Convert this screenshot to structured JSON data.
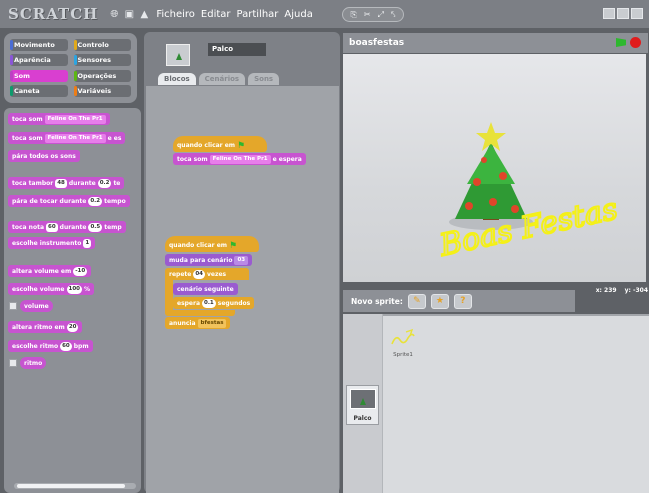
{
  "menubar": {
    "logo": "SCRATCH",
    "icons": [
      "globe-icon",
      "save-icon",
      "share-icon"
    ],
    "menus": [
      "Ficheiro",
      "Editar",
      "Partilhar",
      "Ajuda"
    ]
  },
  "categories": [
    {
      "label": "Movimento",
      "color": "#4a6cd4"
    },
    {
      "label": "Controlo",
      "color": "#e1a91a"
    },
    {
      "label": "Aparência",
      "color": "#8a55d7"
    },
    {
      "label": "Sensores",
      "color": "#2ca5e2"
    },
    {
      "label": "Som",
      "color": "#bb42c3"
    },
    {
      "label": "Operações",
      "color": "#5cb712"
    },
    {
      "label": "Caneta",
      "color": "#0e9a6c"
    },
    {
      "label": "Variáveis",
      "color": "#ee7d16"
    }
  ],
  "selected_category": "Som",
  "palette": {
    "play_sound": "toca som",
    "sound_name": "Feline On The Pr1",
    "play_sound_until": "toca som",
    "until_done_short": "e es",
    "stop_all_sounds": "pára todos os sons",
    "play_drum": "toca tambor",
    "drum_value": "48",
    "drum_for": "durante",
    "drum_beats": "0.2",
    "drum_tail": "te",
    "rest_for": "pára de tocar durante",
    "rest_beats": "0.2",
    "rest_tail": "tempo",
    "play_note": "toca nota",
    "note_value": "60",
    "note_for": "durante",
    "note_beats": "0.5",
    "note_tail": "temp",
    "set_instrument": "escolhe instrumento",
    "instrument_value": "1",
    "change_volume": "altera volume em",
    "change_volume_value": "-10",
    "set_volume": "escolhe volume",
    "set_volume_value": "100",
    "set_volume_unit": "%",
    "volume_reporter": "volume",
    "change_tempo": "altera ritmo em",
    "change_tempo_value": "20",
    "set_tempo": "escolhe ritmo",
    "set_tempo_value": "60",
    "set_tempo_unit": "bpm",
    "tempo_reporter": "ritmo"
  },
  "sprite_header": {
    "name": "Palco",
    "tabs": [
      "Blocos",
      "Cenários",
      "Sons"
    ],
    "active_tab": "Blocos"
  },
  "scripts": {
    "script1_hat": "quando clicar em",
    "script1_play": "toca som",
    "script1_sound": "Feline On The Pr1",
    "script1_until": "e espera",
    "script2_hat": "quando clicar em",
    "script2_switch": "muda para cenário",
    "script2_switch_value": "03",
    "script2_repeat": "repete",
    "script2_repeat_value": "04",
    "script2_repeat_unit": "vezes",
    "script2_next": "cenário seguinte",
    "script2_wait": "espera",
    "script2_wait_value": "0.1",
    "script2_wait_unit": "segundos",
    "script2_broadcast": "anuncia",
    "script2_broadcast_value": "bfestas"
  },
  "stage": {
    "title": "boasfestas",
    "greeting": "Boas Festas",
    "coords_x": "x: 239",
    "coords_y": "y: -304"
  },
  "sprites": {
    "new_sprite_label": "Novo sprite:",
    "sprite1_label": "Sprite1",
    "stage_tile_label": "Palco"
  }
}
